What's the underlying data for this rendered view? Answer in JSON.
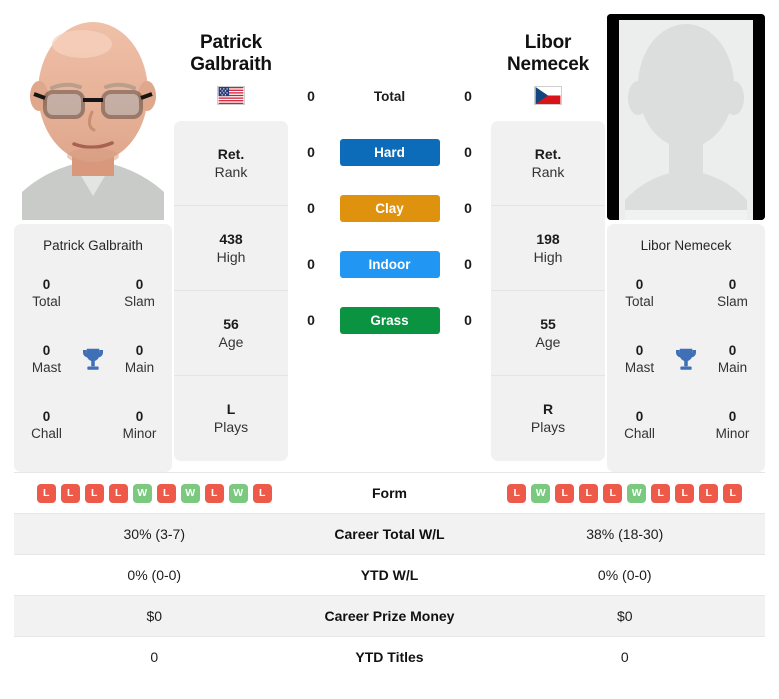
{
  "players": {
    "left": {
      "first_name": "Patrick",
      "last_name": "Galbraith",
      "full_name": "Patrick Galbraith",
      "flag": "us-flag",
      "photo": "player-portrait-photo",
      "rank": "Ret.",
      "rank_label": "Rank",
      "high": "438",
      "high_label": "High",
      "age": "56",
      "age_label": "Age",
      "plays": "L",
      "plays_label": "Plays",
      "titles": {
        "total": "0",
        "total_label": "Total",
        "slam": "0",
        "slam_label": "Slam",
        "mast": "0",
        "mast_label": "Mast",
        "main": "0",
        "main_label": "Main",
        "chall": "0",
        "chall_label": "Chall",
        "minor": "0",
        "minor_label": "Minor"
      },
      "form": [
        "L",
        "L",
        "L",
        "L",
        "W",
        "L",
        "W",
        "L",
        "W",
        "L"
      ],
      "career_total_wl": "30% (3-7)",
      "ytd_wl": "0% (0-0)",
      "career_prize_money": "$0",
      "ytd_titles": "0",
      "surfaces": {
        "total": "0",
        "hard": "0",
        "clay": "0",
        "indoor": "0",
        "grass": "0"
      }
    },
    "right": {
      "first_name": "Libor",
      "last_name": "Nemecek",
      "full_name": "Libor Nemecek",
      "flag": "cz-flag",
      "photo": "player-placeholder-avatar",
      "rank": "Ret.",
      "rank_label": "Rank",
      "high": "198",
      "high_label": "High",
      "age": "55",
      "age_label": "Age",
      "plays": "R",
      "plays_label": "Plays",
      "titles": {
        "total": "0",
        "total_label": "Total",
        "slam": "0",
        "slam_label": "Slam",
        "mast": "0",
        "mast_label": "Mast",
        "main": "0",
        "main_label": "Main",
        "chall": "0",
        "chall_label": "Chall",
        "minor": "0",
        "minor_label": "Minor"
      },
      "form": [
        "L",
        "W",
        "L",
        "L",
        "L",
        "W",
        "L",
        "L",
        "L",
        "L"
      ],
      "career_total_wl": "38% (18-30)",
      "ytd_wl": "0% (0-0)",
      "career_prize_money": "$0",
      "ytd_titles": "0",
      "surfaces": {
        "total": "0",
        "hard": "0",
        "clay": "0",
        "indoor": "0",
        "grass": "0"
      }
    }
  },
  "surfaces": [
    {
      "key": "total",
      "label": "Total",
      "color": "transparent",
      "plain": true
    },
    {
      "key": "hard",
      "label": "Hard",
      "color": "#0c6cba",
      "plain": false
    },
    {
      "key": "clay",
      "label": "Clay",
      "color": "#df920d",
      "plain": false
    },
    {
      "key": "indoor",
      "label": "Indoor",
      "color": "#2196f3",
      "plain": false
    },
    {
      "key": "grass",
      "label": "Grass",
      "color": "#0a9442",
      "plain": false
    }
  ],
  "table_rows": [
    {
      "label": "Form"
    },
    {
      "label": "Career Total W/L"
    },
    {
      "label": "YTD W/L"
    },
    {
      "label": "Career Prize Money"
    },
    {
      "label": "YTD Titles"
    }
  ],
  "labels": {
    "form": "Form",
    "career_total_wl": "Career Total W/L",
    "ytd_wl": "YTD W/L",
    "career_prize_money": "Career Prize Money",
    "ytd_titles": "YTD Titles"
  },
  "colors": {
    "win": "#7bc97f",
    "loss": "#ee5a4a",
    "card_bg": "#f1f1f1",
    "row_alt_bg": "#f2f2f2",
    "trophy": "#3f6fb5"
  },
  "icons": {
    "trophy": "trophy-icon"
  }
}
